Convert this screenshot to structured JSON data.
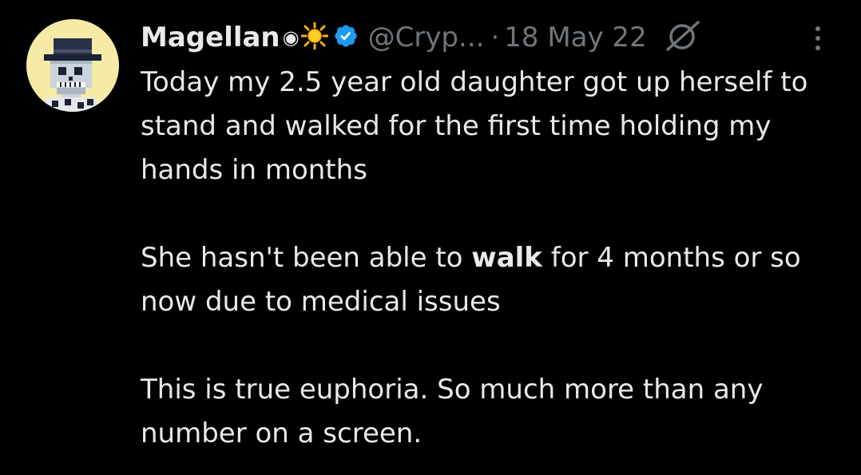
{
  "tweet": {
    "author": {
      "display_name": "Magellan",
      "name_emoji": "◉",
      "handle": "@Cryp...",
      "verified": true,
      "avatar_icon": "pixel-skull-cowboy-avatar",
      "avatar_bg": "#f5eba6"
    },
    "separator": "·",
    "date": "18 May 22",
    "grok_icon": "grok-icon",
    "more_icon": "more-vertical-icon",
    "body": {
      "p1": "Today my 2.5 year old daughter got up herself to stand and walked for the first time holding my hands in months",
      "p2_before": "She hasn't been able to ",
      "p2_bold": "walk",
      "p2_after": " for 4 months or so now due to medical issues",
      "p3": "This is true euphoria. So much more than any number on a screen."
    },
    "colors": {
      "background": "#000000",
      "text": "#e7e9ea",
      "secondary": "#71767b",
      "verified": "#1d9bf0"
    }
  }
}
